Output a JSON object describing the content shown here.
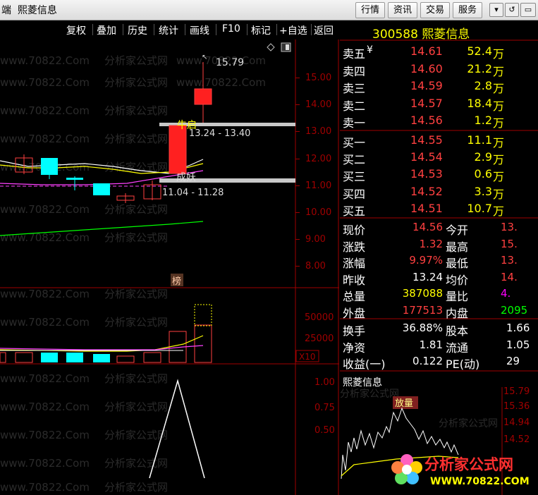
{
  "app": {
    "title_partial": "端",
    "stock_name_title": "熙菱信息",
    "top_buttons": [
      "行情",
      "资讯",
      "交易",
      "服务"
    ],
    "window_buttons": [
      "▾",
      "↺",
      "▭",
      "✕"
    ]
  },
  "toolbar": {
    "items": [
      "复权",
      "叠加",
      "历史",
      "统计",
      "画线",
      "F10",
      "标记",
      "+自选",
      "返回"
    ]
  },
  "price_axis": [
    "15.00",
    "14.00",
    "13.00",
    "12.00",
    "11.00",
    "10.00",
    "9.00",
    "8.00"
  ],
  "annotations": {
    "high_price": "15.79",
    "zone_upper_label": "牛启",
    "zone_upper_range": "13.24 - 13.40",
    "zone_lower_label": "成妖",
    "zone_lower_range": "11.04 - 11.28",
    "board_tag": "榜"
  },
  "volume_axis": [
    "50000",
    "25000"
  ],
  "volume_unit": "X10",
  "indicator_axis": [
    "1.00",
    "0.75",
    "0.50"
  ],
  "quote": {
    "code_name": "300588 熙菱信息",
    "sell": [
      {
        "label": "卖五",
        "suffix": "¥",
        "price": "14.61",
        "vol": "52.4",
        "unit": "万"
      },
      {
        "label": "卖四",
        "suffix": "",
        "price": "14.60",
        "vol": "21.2",
        "unit": "万"
      },
      {
        "label": "卖三",
        "suffix": "",
        "price": "14.59",
        "vol": "2.8",
        "unit": "万"
      },
      {
        "label": "卖二",
        "suffix": "",
        "price": "14.57",
        "vol": "18.4",
        "unit": "万"
      },
      {
        "label": "卖一",
        "suffix": "",
        "price": "14.56",
        "vol": "1.2",
        "unit": "万"
      }
    ],
    "buy": [
      {
        "label": "买一",
        "price": "14.55",
        "vol": "11.1",
        "unit": "万"
      },
      {
        "label": "买二",
        "price": "14.54",
        "vol": "2.9",
        "unit": "万"
      },
      {
        "label": "买三",
        "price": "14.53",
        "vol": "0.6",
        "unit": "万"
      },
      {
        "label": "买四",
        "price": "14.52",
        "vol": "3.3",
        "unit": "万"
      },
      {
        "label": "买五",
        "price": "14.51",
        "vol": "10.7",
        "unit": "万"
      }
    ],
    "stats1": [
      {
        "l": "现价",
        "v": "14.56",
        "vc": "#ff4040",
        "l2": "今开",
        "v2": "13.",
        "v2c": "#ff4040"
      },
      {
        "l": "涨跌",
        "v": "1.32",
        "vc": "#ff4040",
        "l2": "最高",
        "v2": "15.",
        "v2c": "#ff4040"
      },
      {
        "l": "涨幅",
        "v": "9.97%",
        "vc": "#ff4040",
        "l2": "最低",
        "v2": "13.",
        "v2c": "#ff4040"
      },
      {
        "l": "昨收",
        "v": "13.24",
        "vc": "#ffffff",
        "l2": "均价",
        "v2": "14.",
        "v2c": "#ff4040"
      },
      {
        "l": "总量",
        "v": "387088",
        "vc": "#ffff00",
        "l2": "量比",
        "v2": "4.",
        "v2c": "#ff00ff"
      },
      {
        "l": "外盘",
        "v": "177513",
        "vc": "#ff4040",
        "l2": "内盘",
        "v2": "2095",
        "v2c": "#00ff00"
      }
    ],
    "stats2": [
      {
        "l": "换手",
        "v": "36.88%",
        "l2": "股本",
        "v2": "1.66"
      },
      {
        "l": "净资",
        "v": "1.81",
        "l2": "流通",
        "v2": "1.05"
      },
      {
        "l": "收益(一)",
        "v": "0.122",
        "l2": "PE(动)",
        "v2": "29"
      }
    ]
  },
  "mini_chart": {
    "title": "熙菱信息",
    "tag": "放量",
    "axis": [
      "15.79",
      "15.36",
      "14.94",
      "14.52"
    ]
  },
  "watermark": {
    "url": "www.70822.Com",
    "name": "分析家公式网",
    "logo_name": "分析家公式网",
    "logo_url": "WWW.70822.COM"
  }
}
